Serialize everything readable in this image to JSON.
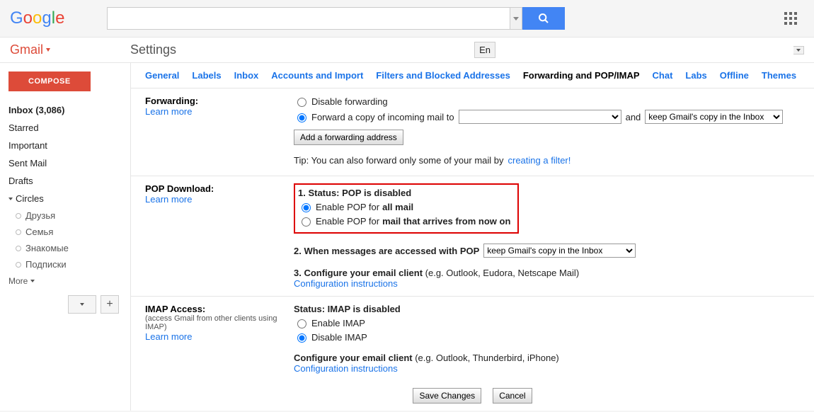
{
  "logo_letters": [
    "G",
    "o",
    "o",
    "g",
    "l",
    "e"
  ],
  "search": {
    "placeholder": ""
  },
  "gmail_label": "Gmail",
  "page_title": "Settings",
  "lang_button": "En",
  "sidebar": {
    "compose": "COMPOSE",
    "items": [
      {
        "label": "Inbox (3,086)",
        "bold": true
      },
      {
        "label": "Starred"
      },
      {
        "label": "Important"
      },
      {
        "label": "Sent Mail"
      },
      {
        "label": "Drafts"
      }
    ],
    "circles_label": "Circles",
    "circles": [
      {
        "label": "Друзья"
      },
      {
        "label": "Семья"
      },
      {
        "label": "Знакомые"
      },
      {
        "label": "Подписки"
      }
    ],
    "more": "More"
  },
  "tabs": [
    "General",
    "Labels",
    "Inbox",
    "Accounts and Import",
    "Filters and Blocked Addresses",
    "Forwarding and POP/IMAP",
    "Chat",
    "Labs",
    "Offline",
    "Themes"
  ],
  "active_tab": 5,
  "forwarding": {
    "title": "Forwarding:",
    "learn": "Learn more",
    "disable": "Disable forwarding",
    "fwcopy": "Forward a copy of incoming mail to",
    "and": "and",
    "dropdown2_selected": "keep Gmail's copy in the Inbox",
    "add_btn": "Add a forwarding address",
    "tip_prefix": "Tip: You can also forward only some of your mail by ",
    "tip_link": "creating a filter!"
  },
  "pop": {
    "title": "POP Download:",
    "learn": "Learn more",
    "status_line": "1. Status: ",
    "status_bold": "POP is disabled",
    "opt1_pre": "Enable POP for ",
    "opt1_bold": "all mail",
    "opt2_pre": "Enable POP for ",
    "opt2_bold": "mail that arrives from now on",
    "line2": "2. When messages are accessed with POP",
    "dropdown_selected": "keep Gmail's copy in the Inbox",
    "line3_pre": "3. Configure your email client ",
    "line3_suf": "(e.g. Outlook, Eudora, Netscape Mail)",
    "config_link": "Configuration instructions"
  },
  "imap": {
    "title": "IMAP Access:",
    "sub": "(access Gmail from other clients using IMAP)",
    "learn": "Learn more",
    "status_pre": "Status: ",
    "status_bold": "IMAP is disabled",
    "enable": "Enable IMAP",
    "disable": "Disable IMAP",
    "conf_pre": "Configure your email client ",
    "conf_suf": "(e.g. Outlook, Thunderbird, iPhone)",
    "config_link": "Configuration instructions"
  },
  "footer": {
    "save": "Save Changes",
    "cancel": "Cancel"
  }
}
